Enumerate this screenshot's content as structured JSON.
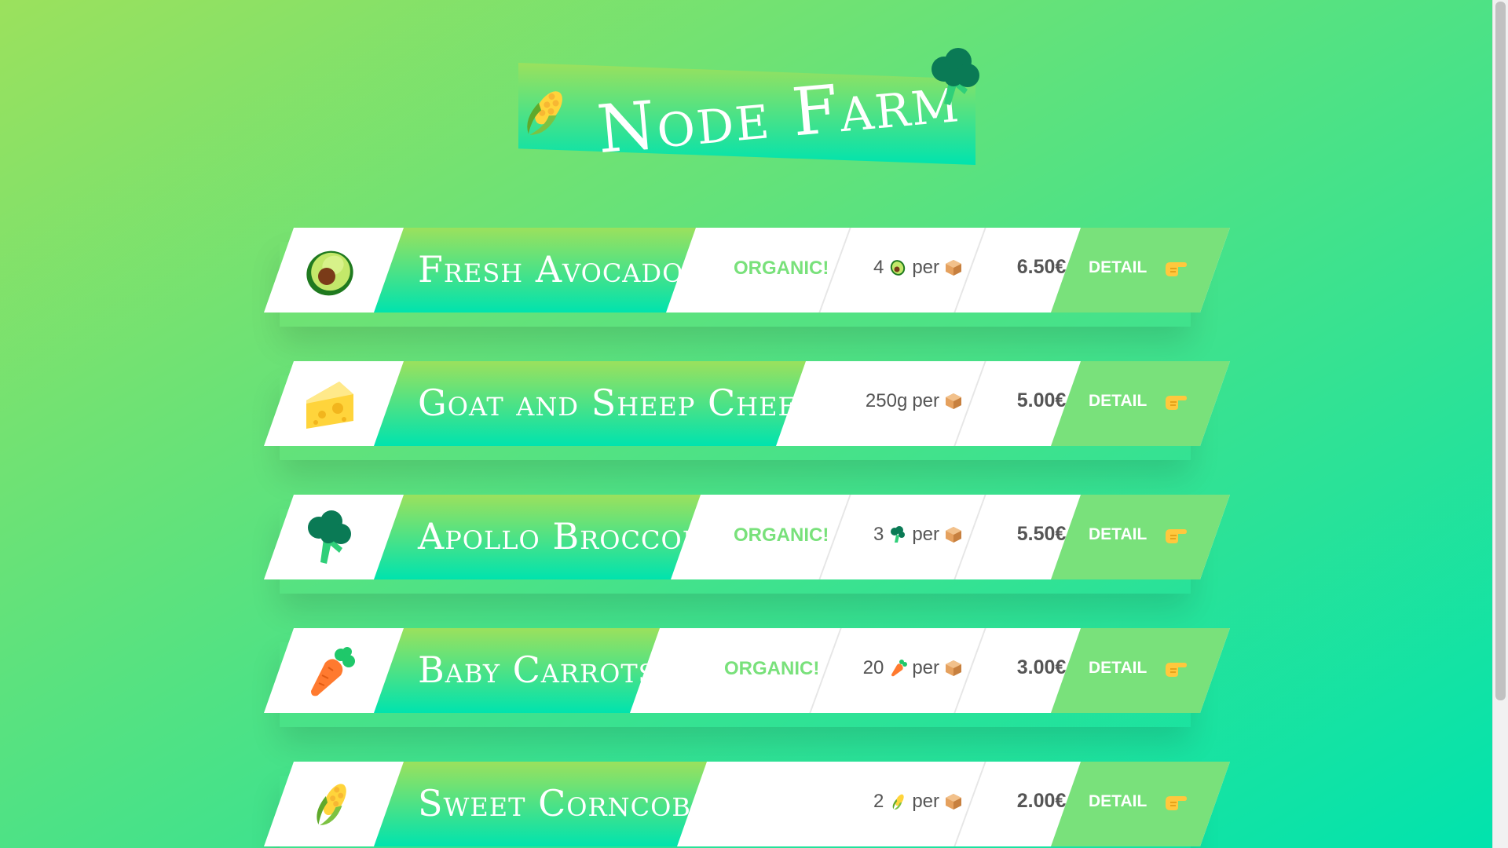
{
  "header": {
    "title": "Node Farm"
  },
  "products": [
    {
      "name": "Fresh Avocados",
      "icon": "avocado-icon",
      "organic": "ORGANIC!",
      "quantity_num": "4",
      "quantity_per": "per",
      "price": "6.50€",
      "detail_label": "DETAIL"
    },
    {
      "name": "Goat and Sheep Cheese",
      "icon": "cheese-icon",
      "organic": "",
      "quantity_num": "250g",
      "quantity_per": "per",
      "price": "5.00€",
      "detail_label": "DETAIL"
    },
    {
      "name": "Apollo Broccoli",
      "icon": "broccoli-icon",
      "organic": "ORGANIC!",
      "quantity_num": "3",
      "quantity_per": "per",
      "price": "5.50€",
      "detail_label": "DETAIL"
    },
    {
      "name": "Baby Carrots",
      "icon": "carrot-icon",
      "organic": "ORGANIC!",
      "quantity_num": "20",
      "quantity_per": "per",
      "price": "3.00€",
      "detail_label": "DETAIL"
    },
    {
      "name": "Sweet Corncobs",
      "icon": "corn-icon",
      "organic": "",
      "quantity_num": "2",
      "quantity_per": "per",
      "price": "2.00€",
      "detail_label": "DETAIL"
    }
  ],
  "colors": {
    "gradient_start": "#9be15d",
    "gradient_end": "#00e3ae",
    "accent_green": "#79e17b",
    "text_dark": "#555555"
  }
}
